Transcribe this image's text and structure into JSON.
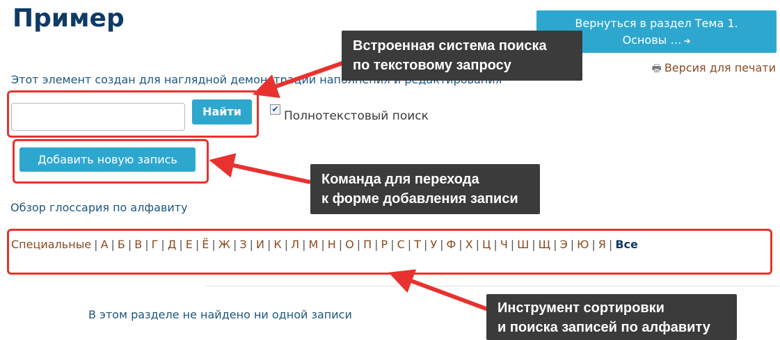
{
  "page": {
    "title": "Пример",
    "intro": "Этот элемент создан для наглядной демонстрации наполнения и редактирования"
  },
  "navigation": {
    "back_button_line1": "Вернуться в раздел Тема 1.",
    "back_button_line2": "Основы …",
    "back_button_icon": "sign-in-icon",
    "print_icon": "printer-icon",
    "print_link": "Версия для печати"
  },
  "search": {
    "input_value": "",
    "button_label": "Найти",
    "fulltext_checked": true,
    "fulltext_label": "Полнотекстовый поиск"
  },
  "actions": {
    "add_entry_label": "Добавить новую запись"
  },
  "glossary": {
    "browse_heading": "Обзор глоссария по алфавиту",
    "letters": [
      "Специальные",
      "А",
      "Б",
      "В",
      "Г",
      "Д",
      "Е",
      "Ё",
      "Ж",
      "З",
      "И",
      "К",
      "Л",
      "М",
      "Н",
      "О",
      "П",
      "Р",
      "С",
      "Т",
      "У",
      "Ф",
      "Х",
      "Ц",
      "Ч",
      "Ш",
      "Щ",
      "Э",
      "Ю",
      "Я"
    ],
    "all_label": "Все",
    "empty_message": "В этом разделе не найдено ни одной записи"
  },
  "annotations": {
    "search_callout_line1": "Встроенная система поиска",
    "search_callout_line2": "по текстовому запросу",
    "add_callout_line1": "Команда для перехода",
    "add_callout_line2": "к форме добавления записи",
    "alphabet_callout_line1": "Инструмент сортировки",
    "alphabet_callout_line2": "и поиска записей по алфавиту",
    "highlight_color": "#e8322f",
    "callout_color": "#3b3b3b"
  },
  "colors": {
    "accent": "#2ea7cf",
    "title": "#0f3b66",
    "link": "#8a4a1e",
    "text_blue": "#1c5680"
  }
}
